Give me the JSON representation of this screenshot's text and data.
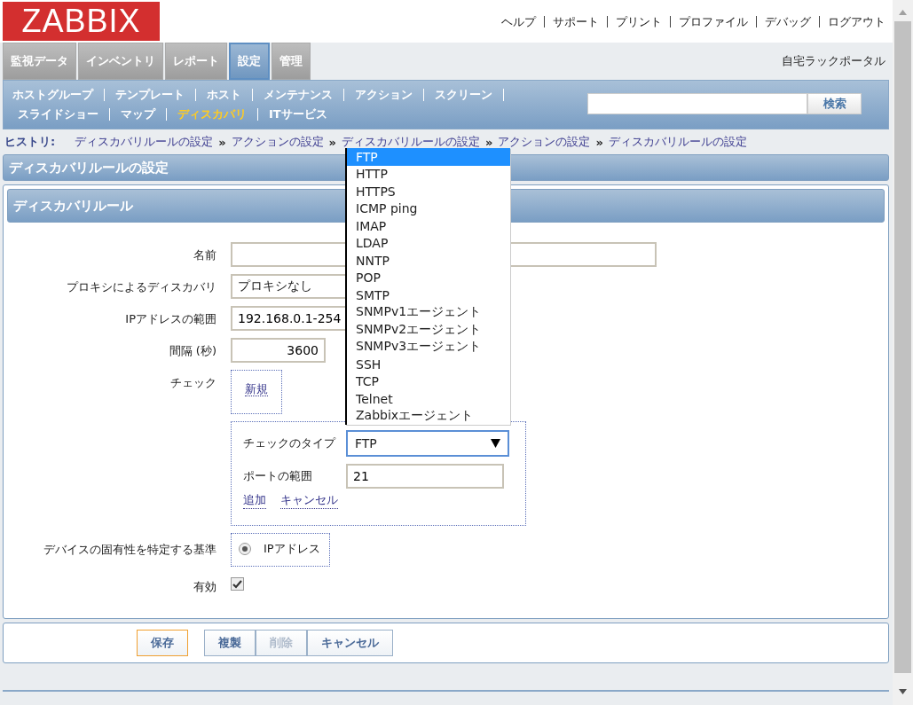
{
  "logo": "ZABBIX",
  "top_links": [
    "ヘルプ",
    "サポート",
    "プリント",
    "プロファイル",
    "デバッグ",
    "ログアウト"
  ],
  "main_tabs": [
    {
      "label": "監視データ",
      "selected": false
    },
    {
      "label": "インベントリ",
      "selected": false
    },
    {
      "label": "レポート",
      "selected": false
    },
    {
      "label": "設定",
      "selected": true
    },
    {
      "label": "管理",
      "selected": false
    }
  ],
  "site_name": "自宅ラックポータル",
  "sub_nav": [
    [
      {
        "label": "ホストグループ",
        "selected": false
      },
      {
        "label": "テンプレート",
        "selected": false
      },
      {
        "label": "ホスト",
        "selected": false
      },
      {
        "label": "メンテナンス",
        "selected": false
      },
      {
        "label": "アクション",
        "selected": false
      },
      {
        "label": "スクリーン",
        "selected": false
      }
    ],
    [
      {
        "label": "スライドショー",
        "selected": false
      },
      {
        "label": "マップ",
        "selected": false
      },
      {
        "label": "ディスカバリ",
        "selected": true
      },
      {
        "label": "ITサービス",
        "selected": false
      }
    ]
  ],
  "search": {
    "button": "検索"
  },
  "history": {
    "label": "ヒストリ:",
    "items": [
      {
        "kind": "link",
        "text": "ディスカバリルールの設定"
      },
      {
        "kind": "sep",
        "text": "»"
      },
      {
        "kind": "link",
        "text": "アクションの設定"
      },
      {
        "kind": "sep",
        "text": "»"
      },
      {
        "kind": "link",
        "text": "ディスカバリルールの設定"
      },
      {
        "kind": "sep",
        "text": "»"
      },
      {
        "kind": "link",
        "text": "アクションの設定"
      },
      {
        "kind": "sep",
        "text": "»"
      },
      {
        "kind": "link",
        "text": "ディスカバリルールの設定"
      }
    ]
  },
  "page_title": "ディスカバリルールの設定",
  "form": {
    "title": "ディスカバリルール",
    "name": {
      "label": "名前"
    },
    "proxy": {
      "label": "プロキシによるディスカバリ",
      "value": "プロキシなし"
    },
    "ip_range": {
      "label": "IPアドレスの範囲",
      "value": "192.168.0.1-254"
    },
    "interval": {
      "label": "間隔 (秒)",
      "value": "3600"
    },
    "checks": {
      "label": "チェック",
      "new_link": "新規"
    },
    "check_form": {
      "type_label": "チェックのタイプ",
      "type_value": "FTP",
      "port_label": "ポートの範囲",
      "port_value": "21",
      "add_link": "追加",
      "cancel_link": "キャンセル"
    },
    "uniqueness": {
      "label": "デバイスの固有性を特定する基準",
      "option": "IPアドレス",
      "selected": true
    },
    "enabled": {
      "label": "有効",
      "checked": true
    }
  },
  "buttons": [
    {
      "label": "保存",
      "kind": "primary",
      "disabled": false
    },
    {
      "label": "複製",
      "kind": "group",
      "disabled": false
    },
    {
      "label": "削除",
      "kind": "group",
      "disabled": true
    },
    {
      "label": "キャンセル",
      "kind": "group",
      "disabled": false
    }
  ],
  "check_type_options": [
    {
      "label": "FTP",
      "selected": true
    },
    {
      "label": "HTTP",
      "selected": false
    },
    {
      "label": "HTTPS",
      "selected": false
    },
    {
      "label": "ICMP ping",
      "selected": false
    },
    {
      "label": "IMAP",
      "selected": false
    },
    {
      "label": "LDAP",
      "selected": false
    },
    {
      "label": "NNTP",
      "selected": false
    },
    {
      "label": "POP",
      "selected": false
    },
    {
      "label": "SMTP",
      "selected": false
    },
    {
      "label": "SNMPv1エージェント",
      "selected": false
    },
    {
      "label": "SNMPv2エージェント",
      "selected": false
    },
    {
      "label": "SNMPv3エージェント",
      "selected": false
    },
    {
      "label": "SSH",
      "selected": false
    },
    {
      "label": "TCP",
      "selected": false
    },
    {
      "label": "Telnet",
      "selected": false
    },
    {
      "label": "Zabbixエージェント",
      "selected": false
    }
  ]
}
